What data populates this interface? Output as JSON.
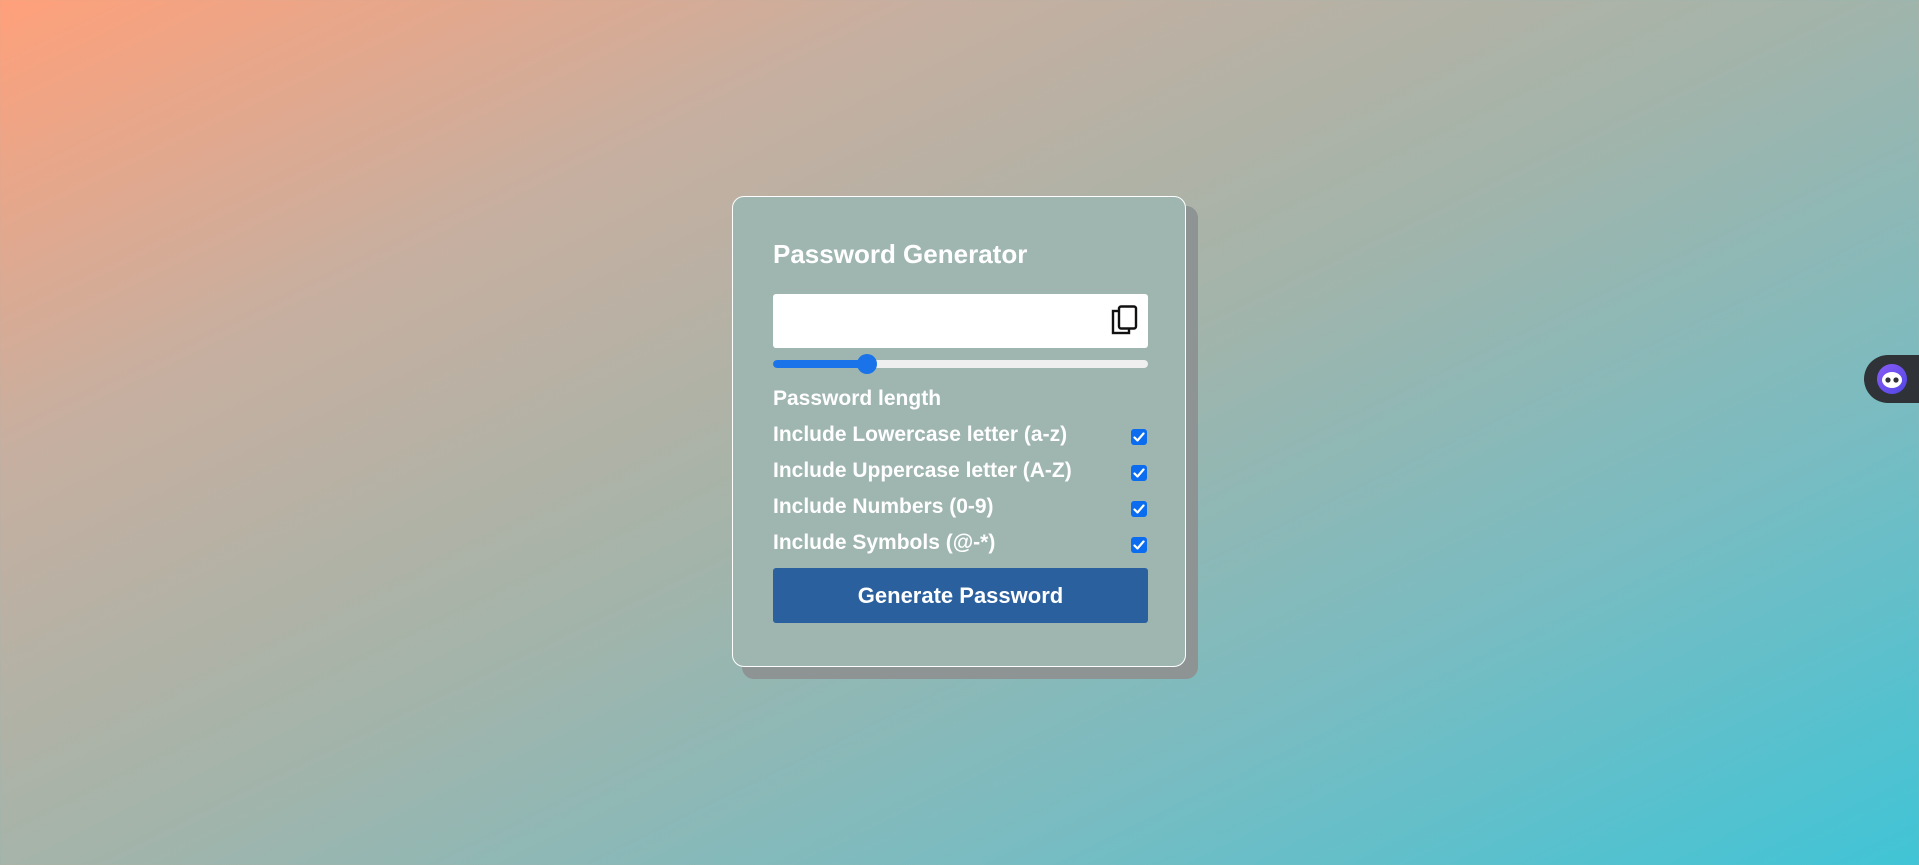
{
  "app": {
    "title": "Password Generator"
  },
  "password_field": {
    "value": "",
    "placeholder": ""
  },
  "length_slider": {
    "value_fraction": 0.25
  },
  "labels": {
    "password_length": "Password length"
  },
  "options": [
    {
      "label": "Include Lowercase letter (a-z)",
      "checked": true
    },
    {
      "label": "Include Uppercase letter (A-Z)",
      "checked": true
    },
    {
      "label": "Include Numbers (0-9)",
      "checked": true
    },
    {
      "label": "Include Symbols (@-*)",
      "checked": true
    }
  ],
  "buttons": {
    "generate_label": "Generate Password"
  },
  "icons": {
    "copy": "copy-icon",
    "side_widget": "assistant-avatar-icon"
  },
  "colors": {
    "accent": "#1a73e8",
    "button": "#2b609e",
    "checkbox": "#0b6cf0"
  }
}
